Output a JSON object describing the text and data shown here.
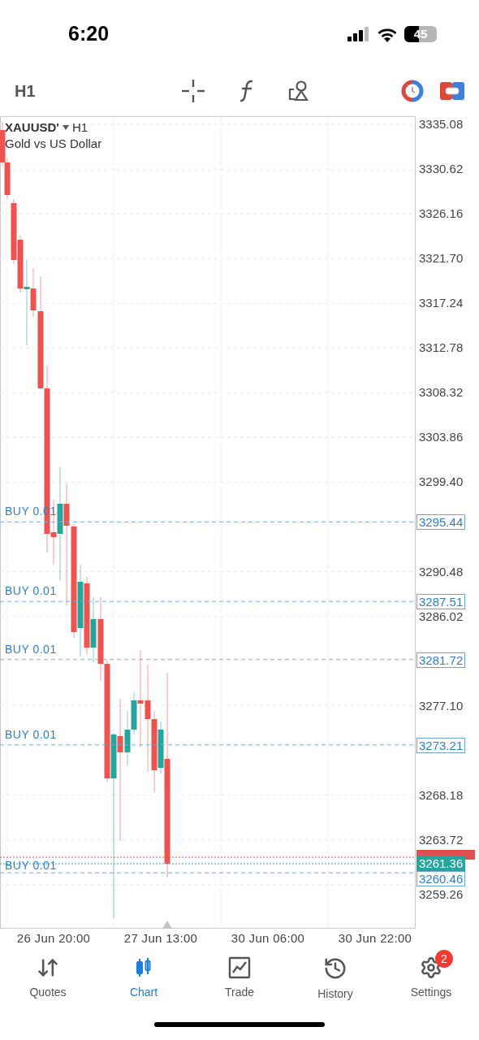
{
  "status_bar": {
    "time": "6:20",
    "battery": "45"
  },
  "toolbar": {
    "timeframe": "H1"
  },
  "chart": {
    "symbol": "XAUUSD'",
    "timeframe": "H1",
    "description": "Gold vs US Dollar",
    "price_ticks": [
      "3335.08",
      "3330.62",
      "3326.16",
      "3321.70",
      "3317.24",
      "3312.78",
      "3308.32",
      "3303.86",
      "3299.40",
      "3290.48",
      "3286.02",
      "3277.10",
      "3268.18",
      "3263.72",
      "3259.26"
    ],
    "orders": [
      {
        "label": "BUY 0.01",
        "price": "3295.44"
      },
      {
        "label": "BUY 0.01",
        "price": "3287.51"
      },
      {
        "label": "BUY 0.01",
        "price": "3281.72"
      },
      {
        "label": "BUY 0.01",
        "price": "3273.21"
      },
      {
        "label": "BUY 0.01",
        "price": "3260.46"
      }
    ],
    "bid": "3261.36",
    "time_ticks": [
      "26 Jun 20:00",
      "27 Jun 13:00",
      "30 Jun 06:00",
      "30 Jun 22:00"
    ]
  },
  "tabs": [
    {
      "label": "Quotes",
      "selected": false
    },
    {
      "label": "Chart",
      "selected": true
    },
    {
      "label": "Trade",
      "selected": false
    },
    {
      "label": "History",
      "selected": false
    },
    {
      "label": "Settings",
      "selected": false,
      "badge": "2"
    }
  ]
}
